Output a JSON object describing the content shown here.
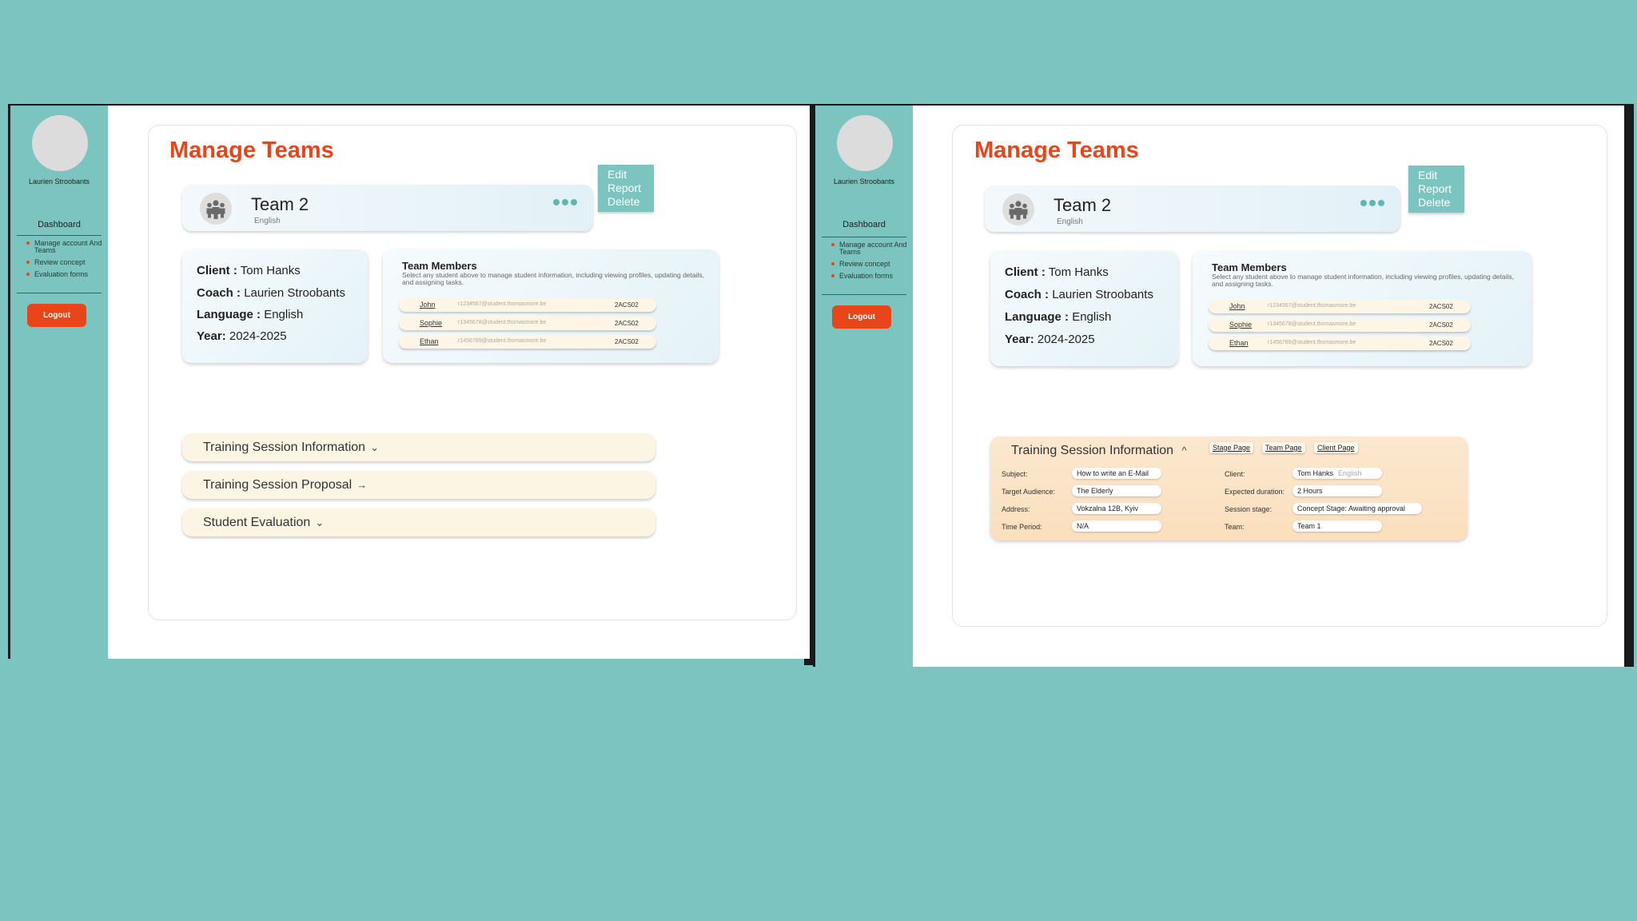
{
  "screens": [
    {
      "user": {
        "name": "Laurien Stroobants"
      },
      "nav": {
        "title": "Dashboard",
        "items": [
          {
            "label": "Manage account And Teams"
          },
          {
            "label": "Review concept"
          },
          {
            "label": "Evaluation forms"
          }
        ],
        "logout": "Logout"
      },
      "page_title": "Manage Teams",
      "team": {
        "name": "Team 2",
        "language": "English"
      },
      "actions": [
        "Edit",
        "Report",
        "Delete"
      ],
      "info": {
        "client_label": "Client :",
        "client": "Tom Hanks",
        "coach_label": "Coach :",
        "coach": "Laurien Stroobants",
        "language_label": "Language :",
        "language": "English",
        "year_label": "Year:",
        "year": "2024-2025"
      },
      "members": {
        "title": "Team Members",
        "description": "Select any student above to manage student information, including viewing profiles, updating details, and assigning tasks.",
        "rows": [
          {
            "name": "John",
            "email": "r1234567@student.thomasmore.be",
            "code": "2ACS02"
          },
          {
            "name": "Sophie",
            "email": "r1345678@student.thomasmore.be",
            "code": "2ACS02"
          },
          {
            "name": "Ethan",
            "email": "r1456789@student.thomasmore.be",
            "code": "2ACS02"
          }
        ]
      },
      "sections": [
        {
          "label": "Training Session Information",
          "icon": "⌄"
        },
        {
          "label": "Training Session Proposal",
          "icon": "→"
        },
        {
          "label": "Student Evaluation",
          "icon": "⌄"
        }
      ]
    },
    {
      "user": {
        "name": "Laurien Stroobants"
      },
      "nav": {
        "title": "Dashboard",
        "items": [
          {
            "label": "Manage account And Teams"
          },
          {
            "label": "Review concept"
          },
          {
            "label": "Evaluation forms"
          }
        ],
        "logout": "Logout"
      },
      "page_title": "Manage Teams",
      "team": {
        "name": "Team 2",
        "language": "English"
      },
      "actions": [
        "Edit",
        "Report",
        "Delete"
      ],
      "info": {
        "client_label": "Client :",
        "client": "Tom Hanks",
        "coach_label": "Coach :",
        "coach": "Laurien Stroobants",
        "language_label": "Language :",
        "language": "English",
        "year_label": "Year:",
        "year": "2024-2025"
      },
      "members": {
        "title": "Team Members",
        "description": "Select any student above to manage student information, including viewing profiles, updating details, and assigning tasks.",
        "rows": [
          {
            "name": "John",
            "email": "r1234567@student.thomasmore.be",
            "code": "2ACS02"
          },
          {
            "name": "Sophie",
            "email": "r1345678@student.thomasmore.be",
            "code": "2ACS02"
          },
          {
            "name": "Ethan",
            "email": "r1456789@student.thomasmore.be",
            "code": "2ACS02"
          }
        ]
      },
      "training_session": {
        "title": "Training Session Information",
        "icon": "^",
        "links": [
          "Stage Page",
          "Team Page",
          "Client Page"
        ],
        "fields_left": [
          {
            "label": "Subject:",
            "value": "How to write an E-Mail"
          },
          {
            "label": "Target Audience:",
            "value": "The Elderly"
          },
          {
            "label": "Address:",
            "value": "Vokzalna 12B, Kyiv"
          },
          {
            "label": "Time Period:",
            "value": "N/A"
          }
        ],
        "fields_right": [
          {
            "label": "Client:",
            "value": "Tom Hanks",
            "extra": "English"
          },
          {
            "label": "Expected duration:",
            "value": "2 Hours"
          },
          {
            "label": "Session stage:",
            "value": "Concept Stage: Awaiting approval"
          },
          {
            "label": "Team:",
            "value": "Team 1"
          }
        ]
      }
    }
  ]
}
